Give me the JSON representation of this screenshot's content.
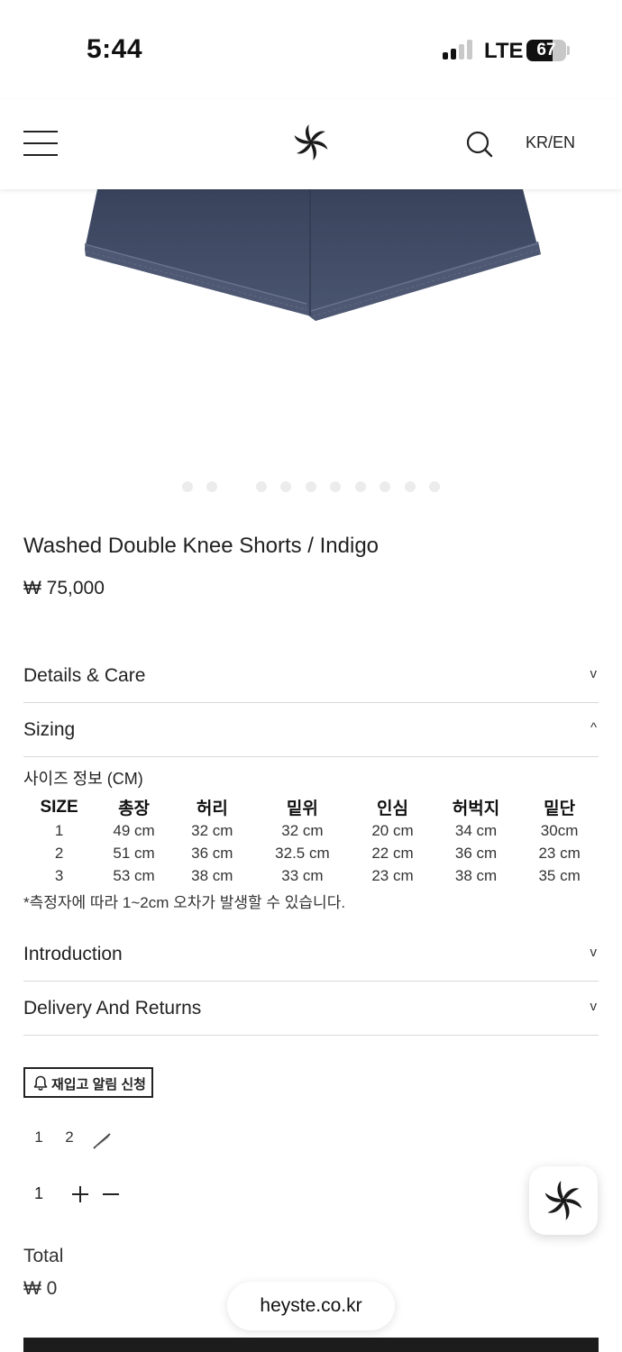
{
  "status_bar": {
    "time": "5:44",
    "network": "LTE",
    "battery": "67",
    "battery_level": 0.67
  },
  "header": {
    "menu_icon": "hamburger-menu-icon",
    "logo_icon": "pinwheel-logo-icon",
    "search_icon": "search-icon",
    "language": "KR/EN"
  },
  "gallery": {
    "slide_count": 11,
    "image": "indigo-denim-shorts"
  },
  "product": {
    "title": "Washed Double Knee Shorts / Indigo",
    "price": "₩ 75,000"
  },
  "accordions": {
    "details": {
      "label": "Details & Care",
      "chevron": "v"
    },
    "sizing": {
      "label": "Sizing",
      "chevron": "^"
    },
    "introduction": {
      "label": "Introduction",
      "chevron": "v"
    },
    "delivery": {
      "label": "Delivery And Returns",
      "chevron": "v"
    }
  },
  "sizing": {
    "heading": "사이즈 정보 (CM)",
    "columns": [
      "SIZE",
      "총장",
      "허리",
      "밑위",
      "인심",
      "허벅지",
      "밑단"
    ],
    "rows": [
      [
        "1",
        "49 cm",
        "32 cm",
        "32 cm",
        "20 cm",
        "34 cm",
        "30cm"
      ],
      [
        "2",
        "51 cm",
        "36 cm",
        "32.5 cm",
        "22 cm",
        "36 cm",
        "23 cm"
      ],
      [
        "3",
        "53 cm",
        "38 cm",
        "33 cm",
        "23 cm",
        "38 cm",
        "35 cm"
      ]
    ],
    "note": "*측정자에 따라 1~2cm 오차가 발생할 수 있습니다."
  },
  "restock": {
    "label": "재입고 알림 신청",
    "icon": "bell-icon"
  },
  "size_options": [
    "1",
    "2"
  ],
  "quantity": {
    "value": "1",
    "plus_icon": "plus-icon",
    "minus_icon": "minus-icon"
  },
  "total": {
    "label": "Total",
    "value": "₩ 0"
  },
  "browser": {
    "url": "heyste.co.kr"
  },
  "colors": {
    "text": "#222222",
    "divider": "#d8d8d8",
    "denim": "#3f4a64",
    "dot": "#ececec",
    "buy_bar": "#1c1c1c"
  }
}
